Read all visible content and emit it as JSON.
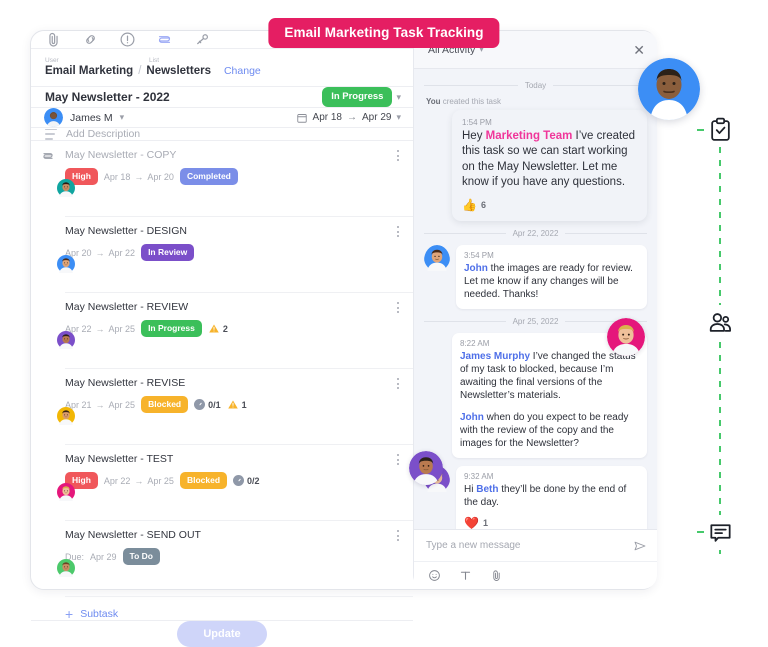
{
  "title_pill": "Email Marketing Task Tracking",
  "toolbar": {
    "icons": [
      "paperclip-icon",
      "link-icon",
      "exclamation-circle-icon",
      "layers-icon",
      "key-icon"
    ],
    "more_label": "more-options"
  },
  "breadcrumb": {
    "user_label": "User",
    "list_label": "List",
    "user_value": "Email Marketing",
    "separator": "/",
    "list_value": "Newsletters",
    "change_label": "Change"
  },
  "task": {
    "title": "May Newsletter - 2022",
    "status": "In Progress",
    "status_color": "#3BBF5A",
    "assignee": "James M",
    "date_start": "Apr 18",
    "date_arrow": "→",
    "date_end": "Apr 29",
    "description_placeholder": "Add Description"
  },
  "subtasks": [
    {
      "name": "May Newsletter - COPY",
      "dim": true,
      "priority": "High",
      "priority_color": "#F0575B",
      "date_start": "Apr 18",
      "date_end": "Apr 20",
      "status": "Completed",
      "status_color": "#7B8EE8",
      "checklist": null,
      "warnings": null,
      "avatar_ring": "#10A5A0"
    },
    {
      "name": "May Newsletter - DESIGN",
      "dim": false,
      "priority": null,
      "priority_color": null,
      "date_start": "Apr 20",
      "date_end": "Apr 22",
      "status": "In Review",
      "status_color": "#7B4FC9",
      "checklist": null,
      "warnings": null,
      "avatar_ring": "#3C8EF5"
    },
    {
      "name": "May Newsletter - REVIEW",
      "dim": false,
      "priority": null,
      "priority_color": null,
      "date_start": "Apr 22",
      "date_end": "Apr 25",
      "status": "In Progress",
      "status_color": "#3BBF5A",
      "checklist": null,
      "warnings": "2",
      "avatar_ring": "#7B4FC9"
    },
    {
      "name": "May Newsletter - REVISE",
      "dim": false,
      "priority": null,
      "priority_color": null,
      "date_start": "Apr 21",
      "date_end": "Apr 25",
      "status": "Blocked",
      "status_color": "#F7B32B",
      "checklist": "0/1",
      "warnings": "1",
      "avatar_ring": "#F2B705"
    },
    {
      "name": "May Newsletter - TEST",
      "dim": false,
      "priority": "High",
      "priority_color": "#F0575B",
      "date_start": "Apr 22",
      "date_end": "Apr 25",
      "status": "Blocked",
      "status_color": "#F7B32B",
      "checklist": "0/2",
      "warnings": null,
      "avatar_ring": "#E5177B"
    },
    {
      "name": "May Newsletter - SEND OUT",
      "dim": false,
      "priority": null,
      "priority_color": null,
      "due_prefix": "Due:",
      "date_start": "Apr 29",
      "date_end": null,
      "status": "To Do",
      "status_color": "#7B8D9B",
      "checklist": null,
      "warnings": null,
      "avatar_ring": "#4CC96B"
    }
  ],
  "add_subtask_label": "Subtask",
  "update_button": "Update",
  "chat": {
    "filter_label": "All Activity",
    "close_label": "close",
    "input_placeholder": "Type a new message",
    "tools": [
      "emoji-icon",
      "text-format-icon",
      "attachment-icon"
    ],
    "send_label": "send",
    "threads": [
      {
        "day": "Today",
        "system_note_bold": "You",
        "system_note_rest": " created this task",
        "messages": [
          {
            "time": "1:54 PM",
            "hero": true,
            "segments": [
              {
                "t": "Hey ",
                "style": "plain"
              },
              {
                "t": "Marketing Team",
                "style": "pink"
              },
              {
                "t": " I’ve created this task so we can start working on the May Newsletter. Let me know if you have any questions.",
                "style": "plain"
              }
            ],
            "reaction_emoji": "👍",
            "reaction_count": "6",
            "avatar_ring": "#3C8EF5",
            "avatar_external": true
          }
        ]
      },
      {
        "day": "Apr 22, 2022",
        "messages": [
          {
            "time": "3:54 PM",
            "hero": false,
            "segments": [
              {
                "t": "John",
                "style": "blue"
              },
              {
                "t": " the images are ready for review. Let me know if any changes will be needed. Thanks!",
                "style": "plain"
              }
            ],
            "avatar_ring": "#3C8EF5"
          }
        ]
      },
      {
        "day": "Apr 25, 2022",
        "messages": [
          {
            "time": "8:22 AM",
            "hero": false,
            "segments": [
              {
                "t": "James Murphy",
                "style": "blue"
              },
              {
                "t": " I’ve changed the status of my task to blocked, because I’m awaiting the final versions of the Newsletter’s materials.",
                "style": "plain"
              }
            ],
            "segments2": [
              {
                "t": "John",
                "style": "blue"
              },
              {
                "t": " when do you expect to be ready with the review of the copy and the images for the Newsletter?",
                "style": "plain"
              }
            ],
            "avatar_ring": "#E5177B",
            "avatar_right": true
          },
          {
            "time": "9:32 AM",
            "hero": false,
            "segments": [
              {
                "t": "Hi ",
                "style": "plain"
              },
              {
                "t": "Beth",
                "style": "blue"
              },
              {
                "t": " they’ll be done by the end of the day.",
                "style": "plain"
              }
            ],
            "reaction_emoji": "❤️",
            "reaction_count": "1",
            "avatar_ring": "#7B4FC9"
          }
        ]
      }
    ]
  },
  "rail": {
    "icons": [
      "clipboard-check-icon",
      "people-icon",
      "chat-bubble-icon"
    ],
    "line_color": "#46C96B"
  }
}
